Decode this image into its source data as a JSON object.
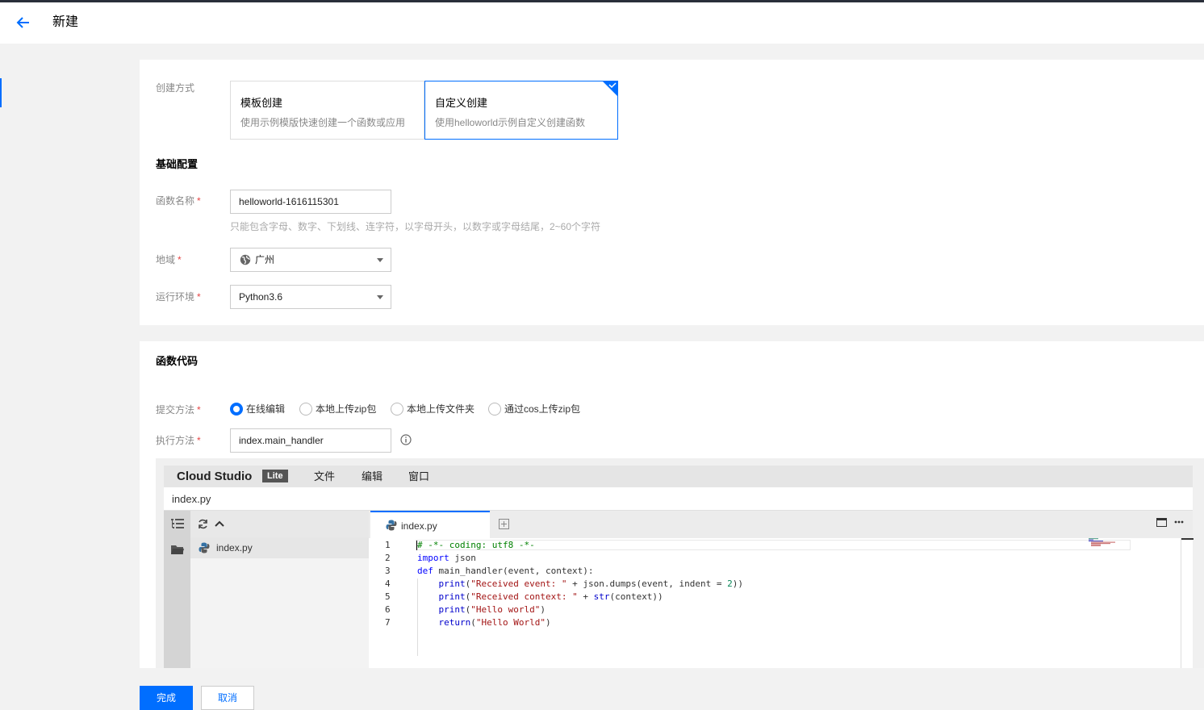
{
  "header": {
    "title": "新建"
  },
  "create_mode": {
    "label": "创建方式",
    "cards": [
      {
        "title": "模板创建",
        "desc": "使用示例模版快速创建一个函数或应用"
      },
      {
        "title": "自定义创建",
        "desc": "使用helloworld示例自定义创建函数"
      }
    ]
  },
  "basic": {
    "section_title": "基础配置",
    "function_name": {
      "label": "函数名称",
      "value": "helloworld-1616115301",
      "hint": "只能包含字母、数字、下划线、连字符，以字母开头，以数字或字母结尾，2~60个字符"
    },
    "region": {
      "label": "地域",
      "value": "广州"
    },
    "runtime": {
      "label": "运行环境",
      "value": "Python3.6"
    },
    "required_mark": "*"
  },
  "code": {
    "section_title": "函数代码",
    "submit": {
      "label": "提交方法",
      "options": [
        "在线编辑",
        "本地上传zip包",
        "本地上传文件夹",
        "通过cos上传zip包"
      ],
      "selected": "在线编辑"
    },
    "handler": {
      "label": "执行方法",
      "value": "index.main_handler"
    }
  },
  "ide": {
    "brand": "Cloud Studio",
    "badge": "Lite",
    "menu": [
      "文件",
      "编辑",
      "窗口"
    ],
    "current_file": "index.py",
    "explorer_item": "index.py",
    "tab": "index.py",
    "lines": [
      "1",
      "2",
      "3",
      "4",
      "5",
      "6",
      "7"
    ]
  },
  "footer": {
    "ok": "完成",
    "cancel": "取消"
  },
  "colors": {
    "accent": "#006eff",
    "required": "#e54545"
  }
}
